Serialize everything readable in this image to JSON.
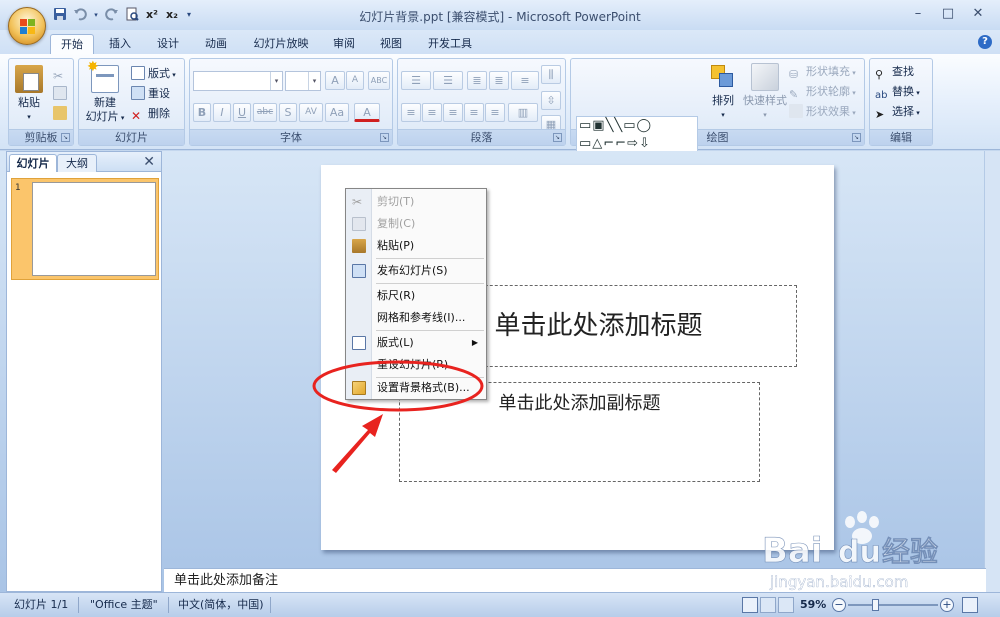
{
  "window": {
    "title": "幻灯片背景.ppt [兼容模式] - Microsoft PowerPoint",
    "controls": [
      "–",
      "□",
      "✕"
    ]
  },
  "qat": {
    "icons": [
      "save-icon",
      "undo-icon",
      "redo-icon",
      "print-preview-icon",
      "superscript-icon",
      "subscript-icon",
      "customize-icon"
    ],
    "superscript": "x²",
    "subscript": "x₂"
  },
  "tabs": [
    "开始",
    "插入",
    "设计",
    "动画",
    "幻灯片放映",
    "审阅",
    "视图",
    "开发工具"
  ],
  "ribbon": {
    "clipboard": {
      "label": "剪贴板",
      "paste": "粘贴"
    },
    "slides": {
      "label": "幻灯片",
      "new_slide_1": "新建",
      "new_slide_2": "幻灯片",
      "layout": "版式",
      "reset": "重设",
      "delete": "删除"
    },
    "font": {
      "label": "字体",
      "grow": "A",
      "shrink": "A",
      "clear": "ABC",
      "bold": "B",
      "italic": "I",
      "underline": "U",
      "strike": "abc",
      "shadow": "S",
      "spacing": "AV",
      "case": "Aa",
      "color": "A"
    },
    "paragraph": {
      "label": "段落"
    },
    "drawing": {
      "label": "绘图",
      "shapes_row1": "▭▣╲╲▭◯",
      "shapes_row2": "▭△⌐⌐⇨⇩",
      "shapes_row3": "△↯⌒⌒{ }",
      "arrange": "排列",
      "quick_styles": "快速样式",
      "shape_fill": "形状填充",
      "shape_outline": "形状轮廓",
      "shape_effects": "形状效果"
    },
    "editing": {
      "label": "编辑",
      "find": "查找",
      "replace": "替换",
      "select": "选择"
    }
  },
  "left_pane": {
    "tab_slides": "幻灯片",
    "tab_outline": "大纲",
    "close": "✕",
    "slide_number": "1"
  },
  "slide": {
    "title_placeholder": "单击此处添加标题",
    "subtitle_placeholder": "单击此处添加副标题"
  },
  "context_menu": {
    "items": [
      {
        "label": "剪切(T)",
        "enabled": false,
        "icon": "scissors-icon"
      },
      {
        "label": "复制(C)",
        "enabled": false,
        "icon": "copy-icon"
      },
      {
        "label": "粘贴(P)",
        "enabled": true,
        "icon": "paste-icon"
      },
      {
        "label": "发布幻灯片(S)",
        "enabled": true,
        "icon": "publish-slides-icon"
      },
      {
        "label": "标尺(R)",
        "enabled": true,
        "icon": ""
      },
      {
        "label": "网格和参考线(I)...",
        "enabled": true,
        "icon": ""
      },
      {
        "label": "版式(L)",
        "enabled": true,
        "icon": "layout-icon",
        "submenu": true
      },
      {
        "label": "重设幻灯片(R)",
        "enabled": true,
        "icon": ""
      },
      {
        "label": "设置背景格式(B)...",
        "enabled": true,
        "icon": "format-background-icon"
      }
    ]
  },
  "notes": {
    "placeholder": "单击此处添加备注"
  },
  "status_bar": {
    "slide_count": "幻灯片 1/1",
    "theme": "\"Office 主题\"",
    "language": "中文(简体，中国)",
    "zoom": "59%"
  },
  "watermark": {
    "brand": "Bai",
    "brand_du": "du",
    "brand_cn": "经验",
    "url": "jingyan.baidu.com"
  },
  "colors": {
    "accent_highlight": "#fbc56b",
    "annotation_red": "#e8231f",
    "ribbon_blue": "#c4d7ee"
  }
}
